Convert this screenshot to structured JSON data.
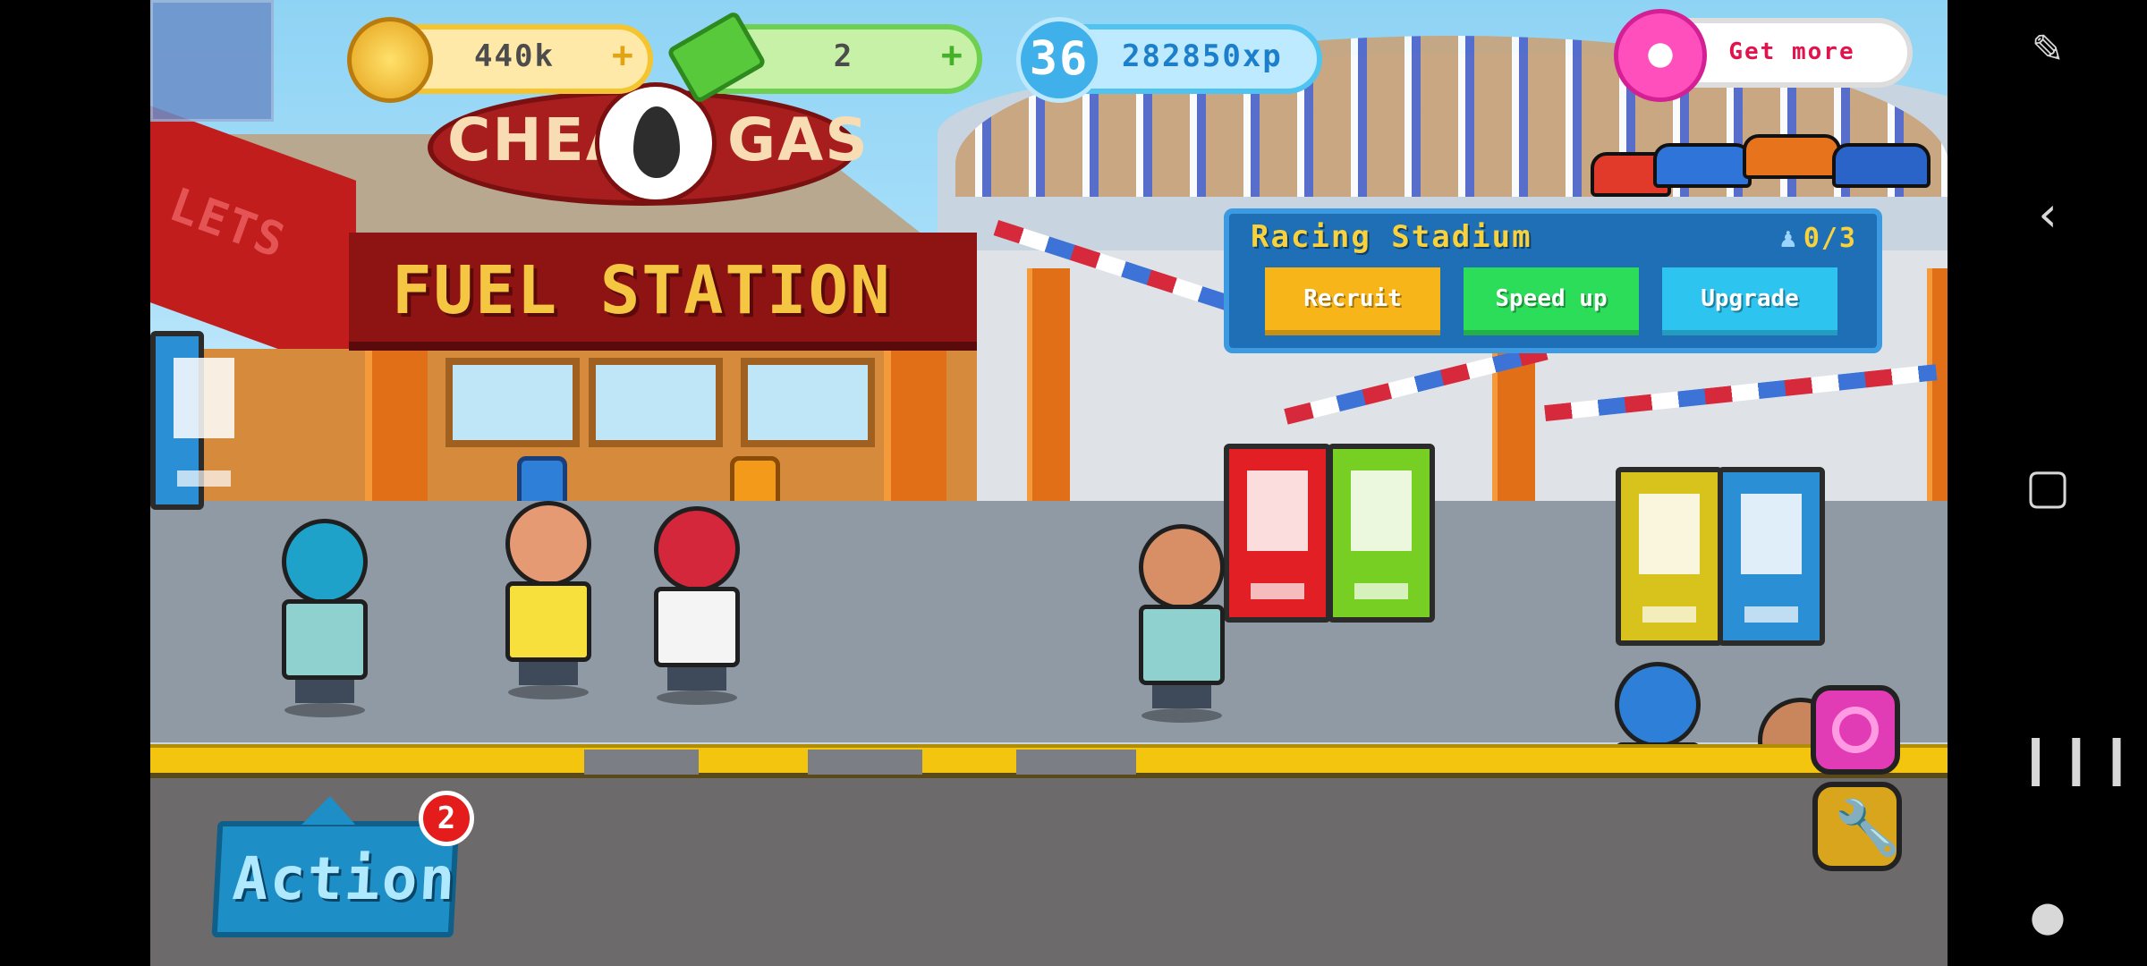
{
  "hud": {
    "coins": "440k",
    "coins_plus": "+",
    "cash": "2",
    "cash_plus": "+",
    "level": "36",
    "xp": "282850xp",
    "get_more": "Get more"
  },
  "signs": {
    "cheap": "CHEAP",
    "gas": "GAS",
    "fuel_station": "FUEL STATION",
    "side_letters": "LETS"
  },
  "panel": {
    "title": "Racing Stadium",
    "count": "0/3",
    "recruit": "Recruit",
    "speed_up": "Speed up",
    "upgrade": "Upgrade"
  },
  "action": {
    "label": "Action",
    "badge": "2"
  },
  "colors": {
    "coin": "#f4c531",
    "cash": "#6ed050",
    "xp": "#4fc4f0",
    "donut": "#ff4fbd",
    "recruit": "#f8b51a",
    "speed_up": "#2cdd5a",
    "upgrade": "#2dc4ef"
  },
  "icons": {
    "coin": "coin-icon",
    "cash": "cash-icon",
    "xp": "xp-star-icon",
    "donut": "donut-icon",
    "target": "target-icon",
    "wrench": "wrench-icon",
    "nav": [
      "screenshot-edit-icon",
      "back-icon",
      "home-icon",
      "recents-icon",
      "game-controller-icon"
    ]
  }
}
